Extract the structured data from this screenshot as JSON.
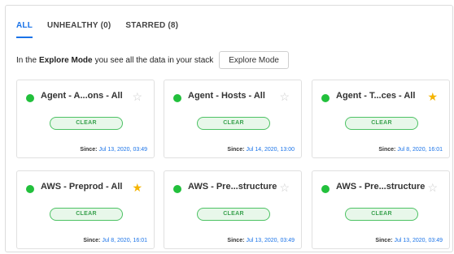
{
  "tabs": [
    {
      "label": "ALL",
      "active": true
    },
    {
      "label": "UNHEALTHY (0)",
      "active": false
    },
    {
      "label": "STARRED (8)",
      "active": false
    }
  ],
  "explore": {
    "prefix": "In the",
    "bold": "Explore Mode",
    "suffix": "you see all the data in your stack",
    "button_label": "Explore Mode"
  },
  "since_label": "Since:",
  "cards": [
    {
      "title": "Agent - A...ons - All",
      "status": "CLEAR",
      "since": "Jul 13, 2020, 03:49",
      "starred": false
    },
    {
      "title": "Agent - Hosts - All",
      "status": "CLEAR",
      "since": "Jul 14, 2020, 13:00",
      "starred": false
    },
    {
      "title": "Agent - T...ces - All",
      "status": "CLEAR",
      "since": "Jul 8, 2020, 16:01",
      "starred": true
    },
    {
      "title": "AWS - Preprod - All",
      "status": "CLEAR",
      "since": "Jul 8, 2020, 16:01",
      "starred": true
    },
    {
      "title": "AWS - Pre...structure",
      "status": "CLEAR",
      "since": "Jul 13, 2020, 03:49",
      "starred": false
    },
    {
      "title": "AWS - Pre...structure",
      "status": "CLEAR",
      "since": "Jul 13, 2020, 03:49",
      "starred": false
    }
  ],
  "colors": {
    "accent": "#1a73e8",
    "status_ok": "#22c03c",
    "star_on": "#f5b400",
    "star_off": "#cccccc"
  },
  "icons": {
    "status": "status-dot-icon",
    "star": "star-icon"
  }
}
